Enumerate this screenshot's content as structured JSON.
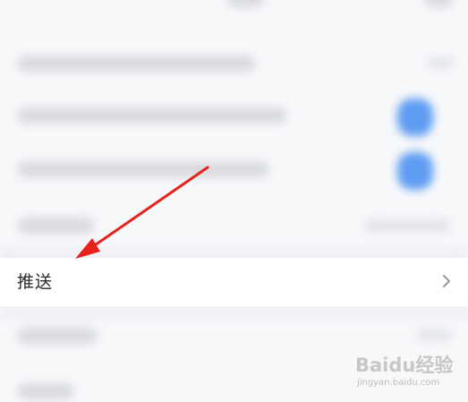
{
  "row": {
    "label": "推送"
  },
  "icons": {
    "chevron": "chevron-right-icon"
  },
  "colors": {
    "arrow": "#e8221b",
    "toggle": "#5e9cf2"
  },
  "watermark": {
    "logo": "Baidu经验",
    "url": "jingyan.baidu.com"
  }
}
